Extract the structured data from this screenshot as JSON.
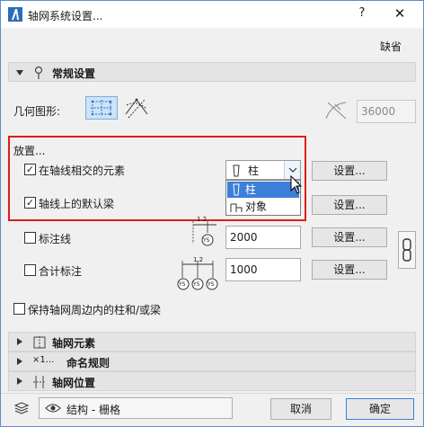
{
  "window": {
    "title": "轴网系统设置...",
    "help": "?",
    "close": "✕"
  },
  "header": {
    "default_label": "缺省"
  },
  "sections": {
    "general": "常规设置",
    "elements": "轴网元素",
    "naming": "命名规则",
    "naming_prefix": "×1...",
    "position": "轴网位置"
  },
  "geometry": {
    "label": "几何图形:",
    "value": "36000"
  },
  "placement": {
    "heading": "放置...",
    "intersect_label": "在轴线相交的元素",
    "intersect_checked": true,
    "beam_label": "轴线上的默认梁",
    "beam_checked": true,
    "dropdown_value": "柱",
    "dropdown_options": [
      "柱",
      "对象"
    ],
    "settings": "设置..."
  },
  "dimension": {
    "label": "标注线",
    "value": "2000",
    "checked": false,
    "mini_top": "1.2",
    "mini_badge": "YS"
  },
  "total": {
    "label": "合计标注",
    "value": "1000",
    "checked": false,
    "mini_top": "1.2",
    "mini_badges": [
      "YS",
      "YS",
      "YS"
    ]
  },
  "keep": {
    "label": "保持轴网周边内的柱和/或梁",
    "checked": false
  },
  "footer": {
    "layer": "结构 - 栅格",
    "cancel": "取消",
    "ok": "确定"
  }
}
